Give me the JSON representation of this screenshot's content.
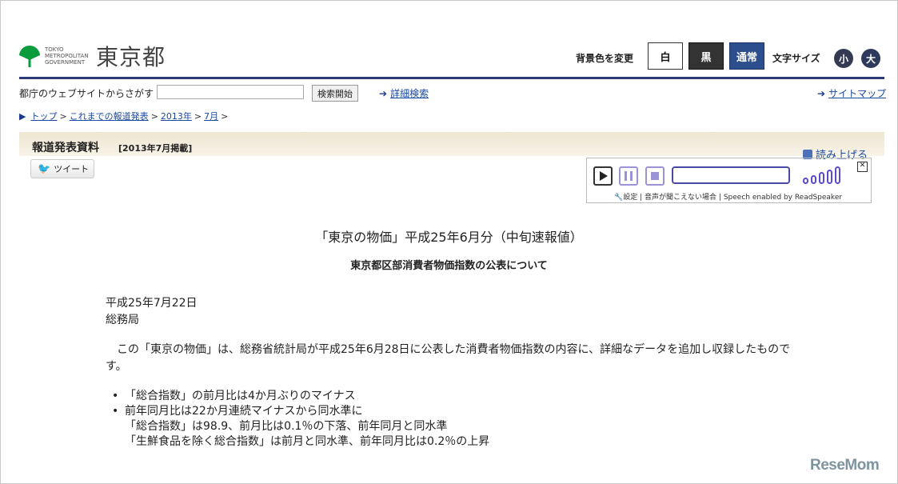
{
  "header": {
    "logo_sub": [
      "TOKYO",
      "METROPOLITAN",
      "GOVERNMENT"
    ],
    "logo_main": "東京都",
    "bg_color_label": "背景色を変更",
    "bg_options": [
      "白",
      "黒",
      "通常"
    ],
    "font_size_label": "文字サイズ",
    "font_size_options": [
      "小",
      "大"
    ]
  },
  "search": {
    "label": "都庁のウェブサイトからさがす",
    "input_value": "",
    "button": "検索開始",
    "advanced_link": "詳細検索",
    "sitemap_link": "サイトマップ"
  },
  "breadcrumb": [
    "トップ",
    "これまでの報道発表",
    "2013年",
    "7月"
  ],
  "press": {
    "title": "報道発表資料",
    "date": "[2013年7月掲載]",
    "tweet": "ツイート",
    "read_aloud": "読み上げる"
  },
  "player": {
    "settings": "設定",
    "sep1": "|",
    "cant_hear": "音声が聞こえない場合",
    "sep2": "|",
    "credit": "Speech enabled by ReadSpeaker"
  },
  "content": {
    "title": "「東京の物価」平成25年6月分（中旬速報値）",
    "subtitle": "東京都区部消費者物価指数の公表について",
    "date": "平成25年7月22日",
    "dept": "総務局",
    "paragraph": "この「東京の物価」は、総務省統計局が平成25年6月28日に公表した消費者物価指数の内容に、詳細なデータを追加し収録したものです。",
    "bullets": [
      "「総合指数」の前月比は4か月ぶりのマイナス",
      "前年同月比は22か月連続マイナスから同水準に",
      "「総合指数」は98.9、前月比は0.1％の下落、前年同月と同水準",
      "「生鮮食品を除く総合指数」は前月と同水準、前年同月比は0.2％の上昇"
    ]
  },
  "watermark": "ReseMom"
}
